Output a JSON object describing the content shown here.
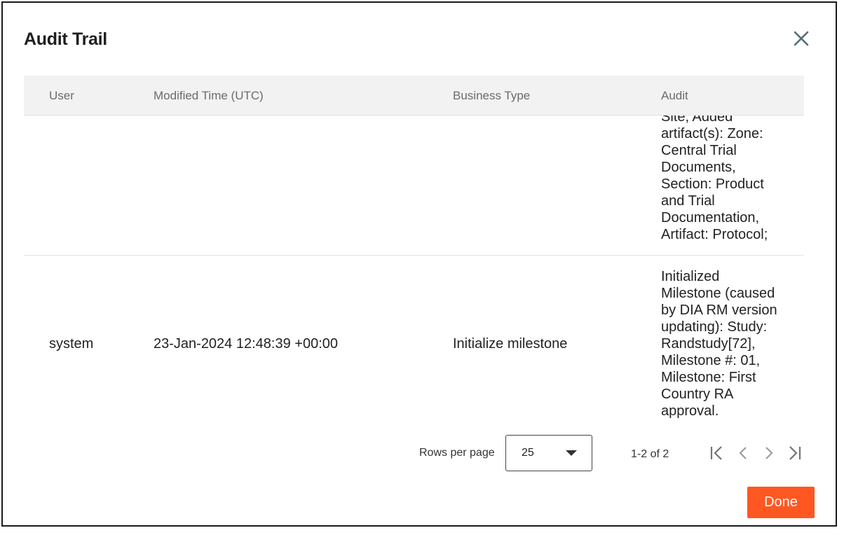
{
  "dialog": {
    "title": "Audit Trail",
    "close_icon": "close-icon"
  },
  "table": {
    "headers": [
      "User",
      "Modified Time (UTC)",
      "Business Type",
      "Audit"
    ],
    "rows": [
      {
        "user": "",
        "modified_time": "",
        "business_type": "",
        "audit": "Site, Added\nartifact(s): Zone:\nCentral Trial\nDocuments,\nSection: Product\nand Trial\nDocumentation,\nArtifact: Protocol;"
      },
      {
        "user": "system",
        "modified_time": "23-Jan-2024 12:48:39 +00:00",
        "business_type": "Initialize milestone",
        "audit": "Initialized\nMilestone (caused\nby DIA RM version\nupdating): Study:\nRandstudy[72],\nMilestone #: 01,\nMilestone: First\nCountry RA\napproval."
      }
    ]
  },
  "pagination": {
    "rows_per_page_label": "Rows per page",
    "rows_per_page_value": "25",
    "range_text": "1-2 of 2",
    "icons": [
      "first-page-icon",
      "previous-page-icon",
      "next-page-icon",
      "last-page-icon"
    ]
  },
  "footer": {
    "done_label": "Done"
  },
  "colors": {
    "accent": "#ff5722",
    "header_bg": "#f2f2f2",
    "close_icon": "#546e7a"
  }
}
